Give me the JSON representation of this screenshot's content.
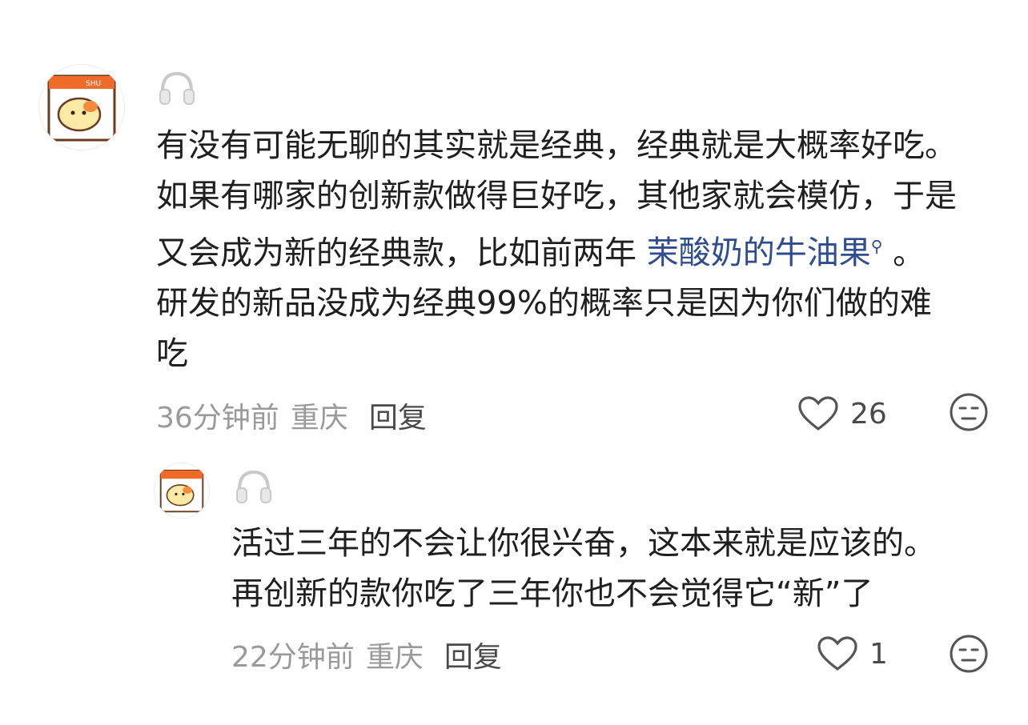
{
  "comments": [
    {
      "avatar": "hamster-sticker-avatar",
      "badge": "headphones-icon",
      "lines": [
        "有没有可能无聊的其实就是经典，经典就是大概率好吃。",
        "如果有哪家的创新款做得巨好吃，其他家就会模仿，于是",
        "又会成为新的经典款，比如前两年 ",
        "研发的新品没成为经典99%的概率只是因为你们做的难",
        "吃"
      ],
      "link_text": "茉酸奶的牛油果",
      "link_after": " 。",
      "time": "36分钟前",
      "location": "重庆",
      "reply_label": "回复",
      "like_count": "26"
    },
    {
      "avatar": "hamster-sticker-avatar",
      "badge": "headphones-icon",
      "lines": [
        "活过三年的不会让你很兴奋，这本来就是应该的。",
        "再创新的款你吃了三年你也不会觉得它“新”了"
      ],
      "time": "22分钟前",
      "location": "重庆",
      "reply_label": "回复",
      "like_count": "1"
    }
  ]
}
